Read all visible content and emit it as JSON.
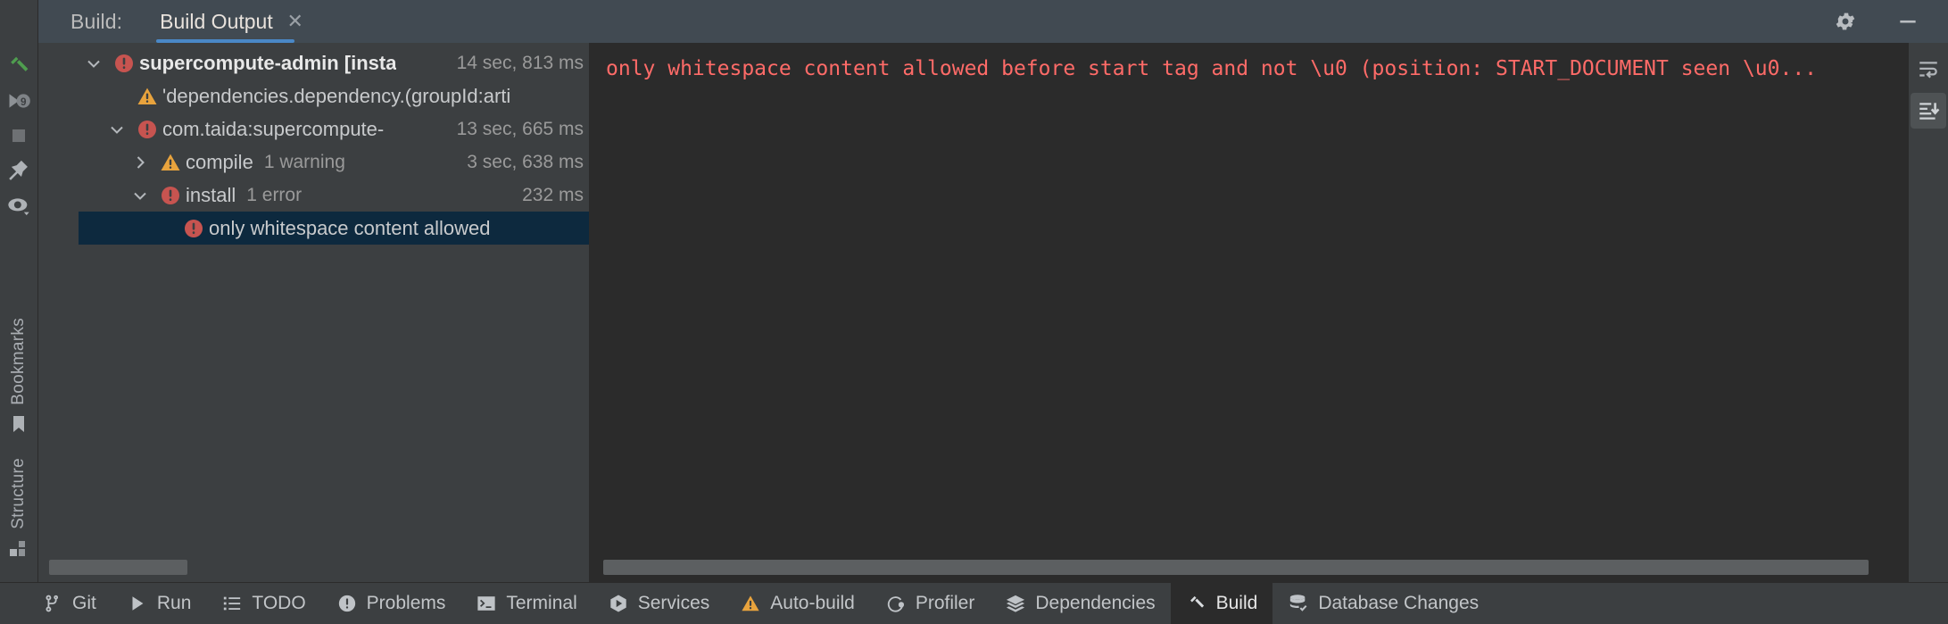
{
  "window": {
    "build_label": "Build:",
    "settings_icon": "gear-icon",
    "minimize_icon": "minimize-icon"
  },
  "tab": {
    "title": "Build Output",
    "close_icon": "close-icon"
  },
  "left_rail": {
    "icons": [
      {
        "name": "build-hammer-icon",
        "color": "#4f9d4f"
      },
      {
        "name": "rerun-icon",
        "color": "#9aa0a6"
      },
      {
        "name": "stop-icon",
        "color": "#6e7174"
      },
      {
        "name": "pin-icon",
        "color": "#aeb2b6"
      },
      {
        "name": "eye-preview-icon",
        "color": "#aeb2b6"
      }
    ],
    "vertical_labels": [
      {
        "label": "Bookmarks",
        "icon": "bookmark-icon"
      },
      {
        "label": "Structure",
        "icon": "structure-grid-icon"
      }
    ]
  },
  "tree": {
    "rows": [
      {
        "twist": "chevron-down",
        "status": "error",
        "label": "supercompute-admin [insta",
        "sub": "",
        "time": "14 sec, 813 ms",
        "indent": 0,
        "bold": true,
        "selected": false
      },
      {
        "twist": "none",
        "status": "warning",
        "label": "'dependencies.dependency.(groupId:arti",
        "sub": "",
        "time": "",
        "indent": 1,
        "bold": false,
        "selected": false
      },
      {
        "twist": "chevron-down",
        "status": "error",
        "label": "com.taida:supercompute-",
        "sub": "",
        "time": "13 sec, 665 ms",
        "indent": 1,
        "bold": false,
        "selected": false
      },
      {
        "twist": "chevron-right",
        "status": "warning",
        "label": "compile",
        "sub": "1 warning",
        "time": "3 sec, 638 ms",
        "indent": 2,
        "bold": false,
        "selected": false
      },
      {
        "twist": "chevron-down",
        "status": "error",
        "label": "install",
        "sub": "1 error",
        "time": "232 ms",
        "indent": 2,
        "bold": false,
        "selected": false
      },
      {
        "twist": "none",
        "status": "error",
        "label": "only whitespace content allowed",
        "sub": "",
        "time": "",
        "indent": 3,
        "bold": false,
        "selected": true
      }
    ],
    "scrollbar": {
      "thumb_left_pct": 2,
      "thumb_width_pct": 25
    }
  },
  "console": {
    "message": "only whitespace content allowed before start tag and not \\u0 (position: START_DOCUMENT seen \\u0...",
    "text_color": "#ff6b68",
    "scrollbar": {
      "thumb_left_pct": 1,
      "thumb_width_pct": 96
    }
  },
  "right_rail": {
    "buttons": [
      {
        "name": "soft-wrap-icon",
        "active": false
      },
      {
        "name": "scroll-to-end-icon",
        "active": true
      }
    ]
  },
  "statusbar": {
    "items": [
      {
        "label": "Git",
        "icon": "git-branch-icon",
        "active": false
      },
      {
        "label": "Run",
        "icon": "run-play-icon",
        "active": false
      },
      {
        "label": "TODO",
        "icon": "todo-list-icon",
        "active": false
      },
      {
        "label": "Problems",
        "icon": "problems-icon",
        "active": false
      },
      {
        "label": "Terminal",
        "icon": "terminal-icon",
        "active": false
      },
      {
        "label": "Services",
        "icon": "services-icon",
        "active": false
      },
      {
        "label": "Auto-build",
        "icon": "warning-triangle-icon",
        "active": false
      },
      {
        "label": "Profiler",
        "icon": "profiler-icon",
        "active": false
      },
      {
        "label": "Dependencies",
        "icon": "dependencies-layers-icon",
        "active": false
      },
      {
        "label": "Build",
        "icon": "build-hammer-icon",
        "active": true
      },
      {
        "label": "Database Changes",
        "icon": "database-changes-icon",
        "active": false
      }
    ]
  },
  "colors": {
    "accent": "#4a88c7",
    "error": "#c75450",
    "warning": "#e8a33d",
    "selection": "#0d293e",
    "console_bg": "#2b2b2b",
    "panel_bg": "#3c3f41"
  }
}
